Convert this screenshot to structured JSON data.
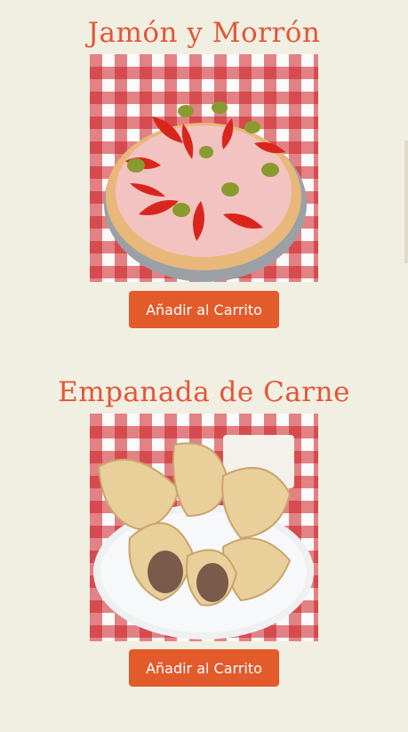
{
  "products": [
    {
      "title": "Jamón y Morrón",
      "image": "pizza-jamon-morron",
      "button_label": "Añadir al Carrito"
    },
    {
      "title": "Empanada de Carne",
      "image": "empanadas-carne",
      "button_label": "Añadir al Carrito"
    }
  ],
  "colors": {
    "background": "#f1efe1",
    "title": "#e2573a",
    "button": "#e35a2b",
    "button_text": "#ffffff"
  }
}
